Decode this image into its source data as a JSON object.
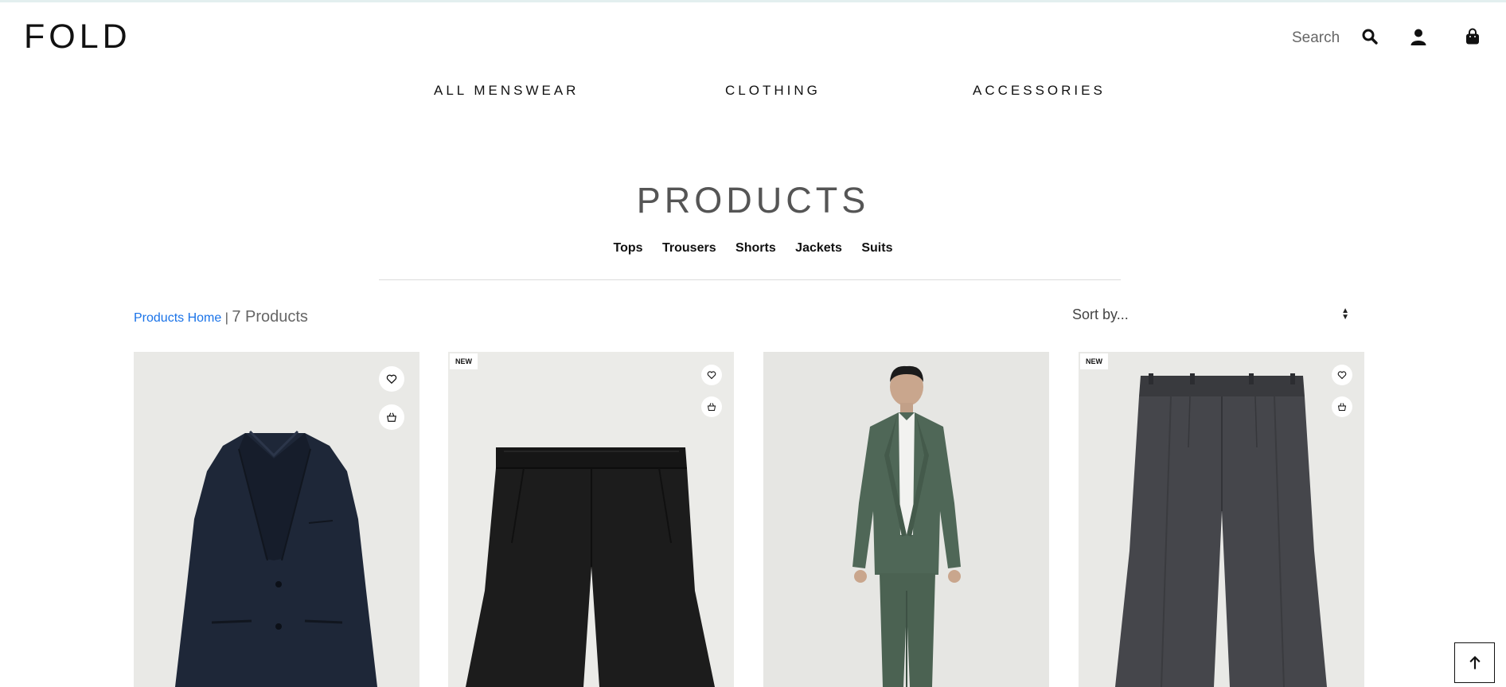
{
  "header": {
    "logo": "FOLD",
    "search_label": "Search",
    "icons": [
      "search-icon",
      "account-icon",
      "cart-icon"
    ]
  },
  "nav": {
    "items": [
      "ALL MENSWEAR",
      "CLOTHING",
      "ACCESSORIES"
    ]
  },
  "page": {
    "title": "PRODUCTS",
    "subcategories": [
      "Tops",
      "Trousers",
      "Shorts",
      "Jackets",
      "Suits"
    ]
  },
  "breadcrumb": {
    "home": "Products Home",
    "separator": " | ",
    "count": "7 Products"
  },
  "sort": {
    "selected": "Sort by..."
  },
  "products": [
    {
      "badge": "",
      "depicts": "navy-blazer"
    },
    {
      "badge": "NEW",
      "depicts": "black-shorts"
    },
    {
      "badge": "",
      "depicts": "green-suit-model"
    },
    {
      "badge": "NEW",
      "depicts": "grey-check-trousers"
    }
  ],
  "colors": {
    "link": "#1a73e8",
    "card_background": "#ebebe8",
    "text": "#111111"
  }
}
